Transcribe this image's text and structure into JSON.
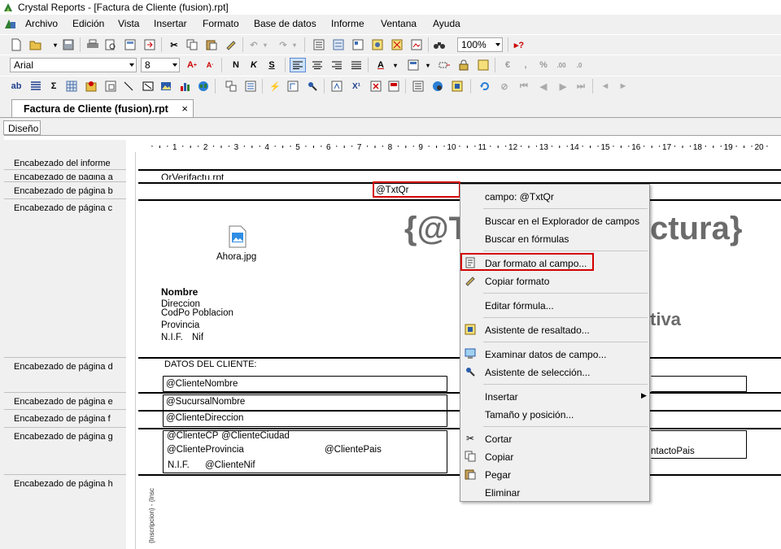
{
  "window": {
    "title": "Crystal Reports - [Factura de Cliente (fusion).rpt]"
  },
  "menu": [
    {
      "label": "Archivo"
    },
    {
      "label": "Edición"
    },
    {
      "label": "Vista"
    },
    {
      "label": "Insertar"
    },
    {
      "label": "Formato"
    },
    {
      "label": "Base de datos"
    },
    {
      "label": "Informe"
    },
    {
      "label": "Ventana"
    },
    {
      "label": "Ayuda"
    }
  ],
  "toolbar": {
    "zoom": "100%",
    "font_name": "Arial",
    "font_size": "8",
    "bold": "N",
    "italic": "K",
    "underline": "S"
  },
  "tabs": {
    "document": "Factura de Cliente (fusion).rpt",
    "close": "×",
    "design": "Diseño"
  },
  "sections": [
    "Encabezado del informe",
    "Encabezado de página a",
    "Encabezado de página b",
    "Encabezado de página c",
    "Encabezado de página d",
    "Encabezado de página e",
    "Encabezado de página f",
    "Encabezado de página g",
    "Encabezado de página h"
  ],
  "ruler": [
    "1",
    "2",
    "3",
    "4",
    "5",
    "6",
    "7",
    "8",
    "9",
    "10",
    "11",
    "12",
    "13",
    "14",
    "15",
    "16",
    "17",
    "18",
    "19",
    "20"
  ],
  "report": {
    "qr_file": "QrVerifactu.rpt",
    "txt_qr": "@TxtQr",
    "image_caption": "Ahora.jpg",
    "big_formula": "{@Titulo factura}",
    "big_formula_visible_left": "{@T",
    "big_formula_visible_right": "ctura}",
    "rectificativa_suffix": "tiva",
    "company": {
      "name": "Nombre",
      "address": "Direccion",
      "cp_city": "CodPo Poblacion",
      "province": "Provincia",
      "nif_label": "N.I.F.",
      "nif": "Nif"
    },
    "client_header": "DATOS DEL CLIENTE:",
    "client_name": "@ClienteNombre",
    "branch_name": "@SucursalNombre",
    "client_address": "@ClienteDireccion",
    "client_cp": "@ClienteCP",
    "client_city": "@ClienteCiudad",
    "client_province": "@ClienteProvincia",
    "client_country": "@ClientePais",
    "client_nif_label": "N.I.F.",
    "client_nif": "@ClienteNif",
    "contact_country": "ntactoPais",
    "vertical_text": "{Inscripcion} - {Insc"
  },
  "context_menu": {
    "items": [
      {
        "label": "campo: @TxtQr",
        "icon": ""
      },
      {
        "label": "Buscar en el Explorador de campos",
        "icon": ""
      },
      {
        "label": "Buscar en fórmulas",
        "icon": ""
      },
      {
        "label": "Dar formato al campo...",
        "icon": "format-field-icon"
      },
      {
        "label": "Copiar formato",
        "icon": "format-painter-icon"
      },
      {
        "label": "Editar fórmula...",
        "icon": ""
      },
      {
        "label": "Asistente de resaltado...",
        "icon": "highlight-icon"
      },
      {
        "label": "Examinar datos de campo...",
        "icon": "browse-data-icon"
      },
      {
        "label": "Asistente de selección...",
        "icon": "select-expert-icon"
      },
      {
        "label": "Insertar",
        "icon": ""
      },
      {
        "label": "Tamaño y posición...",
        "icon": ""
      },
      {
        "label": "Cortar",
        "icon": "scissors-icon"
      },
      {
        "label": "Copiar",
        "icon": "copy-icon"
      },
      {
        "label": "Pegar",
        "icon": "paste-icon"
      },
      {
        "label": "Eliminar",
        "icon": ""
      }
    ]
  },
  "colors": {
    "highlight_red": "#d40000",
    "formula_gray": "#6b6b6b"
  }
}
